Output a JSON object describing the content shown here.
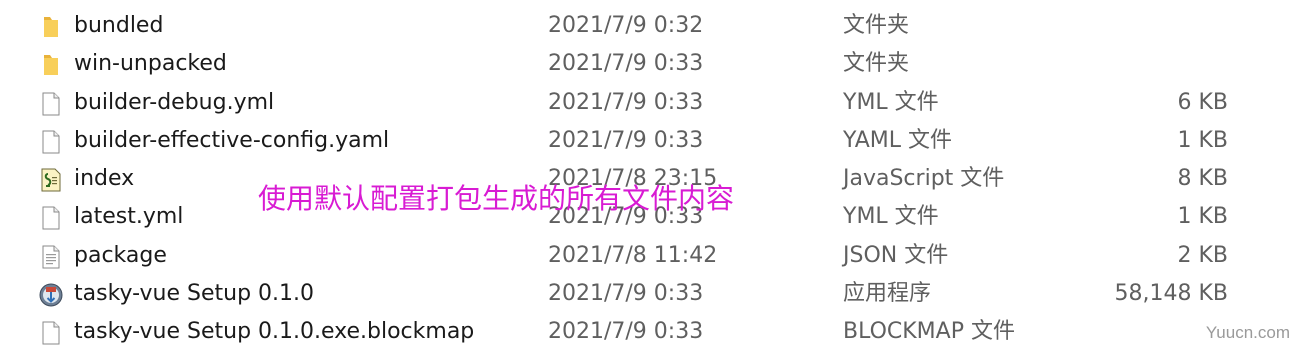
{
  "files": [
    {
      "name": "bundled",
      "date": "2021/7/9 0:32",
      "type": "文件夹",
      "size": "",
      "icon": "folder-icon"
    },
    {
      "name": "win-unpacked",
      "date": "2021/7/9 0:33",
      "type": "文件夹",
      "size": "",
      "icon": "folder-icon"
    },
    {
      "name": "builder-debug.yml",
      "date": "2021/7/9 0:33",
      "type": "YML 文件",
      "size": "6 KB",
      "icon": "document-icon"
    },
    {
      "name": "builder-effective-config.yaml",
      "date": "2021/7/9 0:33",
      "type": "YAML 文件",
      "size": "1 KB",
      "icon": "document-icon"
    },
    {
      "name": "index",
      "date": "2021/7/8 23:15",
      "type": "JavaScript 文件",
      "size": "8 KB",
      "icon": "javascript-file-icon"
    },
    {
      "name": "latest.yml",
      "date": "2021/7/9 0:33",
      "type": "YML 文件",
      "size": "1 KB",
      "icon": "document-icon"
    },
    {
      "name": "package",
      "date": "2021/7/8 11:42",
      "type": "JSON 文件",
      "size": "2 KB",
      "icon": "text-file-icon"
    },
    {
      "name": "tasky-vue Setup 0.1.0",
      "date": "2021/7/9 0:33",
      "type": "应用程序",
      "size": "58,148 KB",
      "icon": "installer-icon"
    },
    {
      "name": "tasky-vue Setup 0.1.0.exe.blockmap",
      "date": "2021/7/9 0:33",
      "type": "BLOCKMAP 文件",
      "size": "",
      "icon": "document-icon"
    }
  ],
  "annotation": "使用默认配置打包生成的所有文件内容",
  "watermark": "Yuucn.com",
  "colors": {
    "annotation": "#d81bd3",
    "folder": "#f6c744",
    "secondary_text": "#5f5f5f"
  }
}
